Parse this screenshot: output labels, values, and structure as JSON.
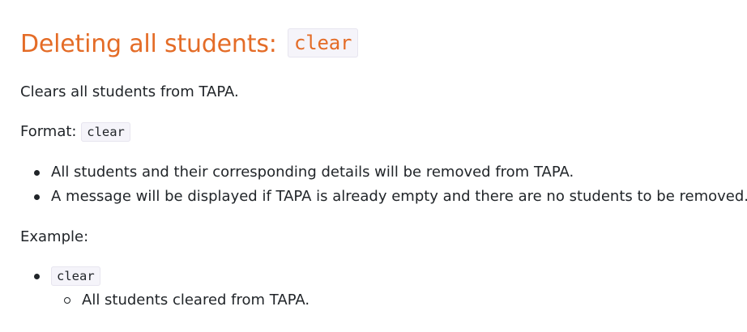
{
  "section": {
    "heading_text": "Deleting all students:",
    "heading_code": "clear",
    "description": "Clears all students from TAPA.",
    "format_label": "Format:",
    "format_code": "clear",
    "notes": [
      "All students and their corresponding details will be removed from TAPA.",
      "A message will be displayed if TAPA is already empty and there are no students to be removed."
    ],
    "example_label": "Example:",
    "examples": [
      {
        "command": "clear",
        "result": "All students cleared from TAPA."
      }
    ]
  },
  "colors": {
    "heading": "#e46c27",
    "text": "#212529",
    "code_bg": "#f5f4fa"
  }
}
